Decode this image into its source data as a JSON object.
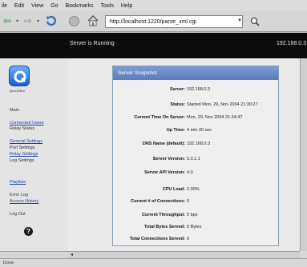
{
  "menu": [
    "ile",
    "Edit",
    "View",
    "Go",
    "Bookmarks",
    "Tools",
    "Help"
  ],
  "address": {
    "url": "http://localhost:1220/parse_xml.cgi"
  },
  "header": {
    "status": "Server is Running",
    "ip": "192.168.0.3"
  },
  "sidebar": {
    "logo_text": "QuickTime",
    "items": [
      {
        "label": "Main",
        "link": false
      },
      {
        "label": "Connected Users",
        "link": true
      },
      {
        "label": "Relay Status",
        "link": false
      },
      {
        "label": "General Settings",
        "link": true
      },
      {
        "label": "Port Settings",
        "link": false
      },
      {
        "label": "Relay Settings",
        "link": true
      },
      {
        "label": "Log Settings",
        "link": false
      },
      {
        "label": "Playlists",
        "link": true
      },
      {
        "label": "Error Log",
        "link": false
      },
      {
        "label": "Access History",
        "link": true
      },
      {
        "label": "Log Out",
        "link": false
      }
    ]
  },
  "panel": {
    "title": "Server Snapshot",
    "rows": [
      {
        "label": "Server:",
        "value": "192.168.0.3"
      },
      {
        "label": "Status:",
        "value": "Started Mon, 29, Nov 2004 21:30:27"
      },
      {
        "label": "Current Time On Server:",
        "value": "Mon, 29, Nov 2004 21:34:47"
      },
      {
        "label": "Up Time:",
        "value": "4 min 20 sec"
      },
      {
        "label": "DNS Name (default):",
        "value": "192.168.0.3"
      },
      {
        "label": "Server Version:",
        "value": "5.0.1.1"
      },
      {
        "label": "Server API Version:",
        "value": "4.0"
      },
      {
        "label": "CPU Load:",
        "value": "2.00%"
      },
      {
        "label": "Current # of Connections:",
        "value": "0"
      },
      {
        "label": "Current Throughput:",
        "value": "0 bps"
      },
      {
        "label": "Total Bytes Served:",
        "value": "0 Bytes"
      },
      {
        "label": "Total Connections Served:",
        "value": "0"
      }
    ]
  },
  "statusbar": {
    "text": "Done"
  },
  "colors": {
    "header_bg": "#0b0b0b",
    "panel_title_bg": "#5a7cbc",
    "link": "#1e3ea8"
  },
  "icons": [
    "back-icon",
    "forward-icon",
    "reload-icon",
    "stop-icon",
    "home-icon",
    "search-icon",
    "quicktime-logo-icon",
    "help-icon"
  ]
}
